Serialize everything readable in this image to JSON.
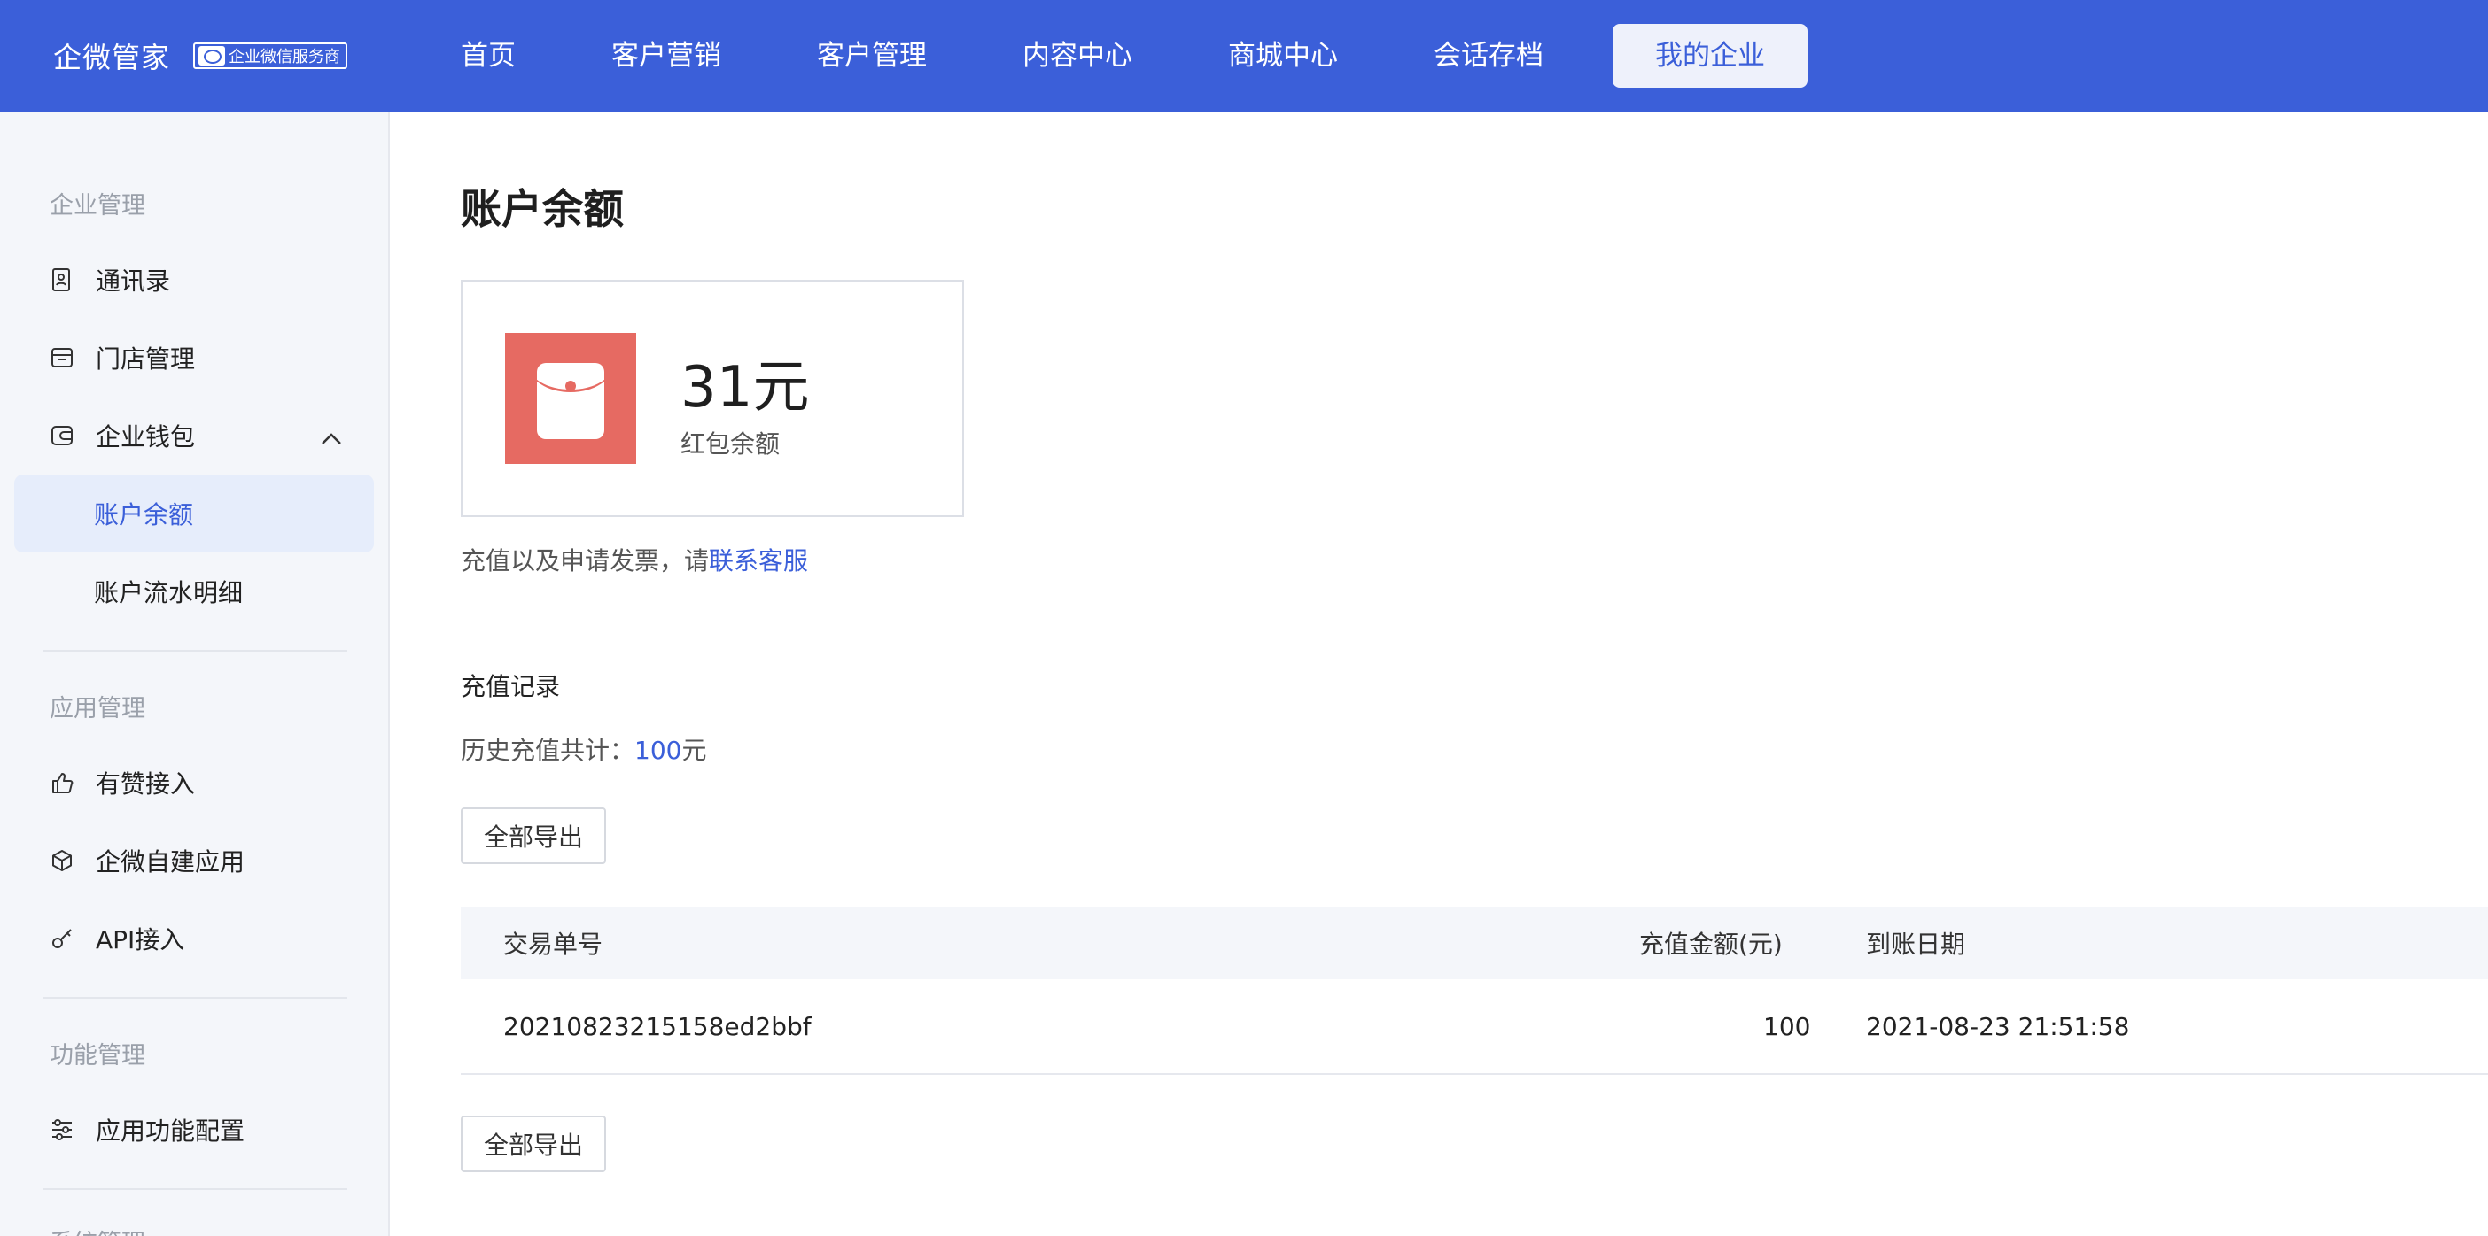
{
  "topbar": {
    "brand_name": "企微管家",
    "brand_badge": "企业微信服务商",
    "nav": [
      "首页",
      "客户营销",
      "客户管理",
      "内容中心",
      "商城中心",
      "会话存档",
      "我的企业"
    ],
    "active_nav": "我的企业"
  },
  "sidebar": {
    "group1": "企业管理",
    "contacts": "通讯录",
    "stores": "门店管理",
    "wallet": "企业钱包",
    "balance": "账户余额",
    "flow": "账户流水明细",
    "group2": "应用管理",
    "youzan": "有赞接入",
    "self_app": "企微自建应用",
    "api": "API接入",
    "group3": "功能管理",
    "feature_config": "应用功能配置",
    "group4": "系统管理"
  },
  "main": {
    "title": "账户余额",
    "balance_amount": "31元",
    "balance_label": "红包余额",
    "tip_prefix": "充值以及申请发票，请",
    "tip_link": "联系客服",
    "section_title": "充值记录",
    "total_prefix": "历史充值共计：",
    "total_value": "100",
    "total_unit": "元",
    "export_label": "全部导出",
    "table": {
      "headers": [
        "交易单号",
        "充值金额(元)",
        "到账日期"
      ],
      "rows": [
        [
          "20210823215158ed2bbf",
          "100",
          "2021-08-23 21:51:58"
        ]
      ]
    }
  },
  "colors": {
    "primary": "#3b5fd9",
    "redpack": "#e66a62"
  }
}
